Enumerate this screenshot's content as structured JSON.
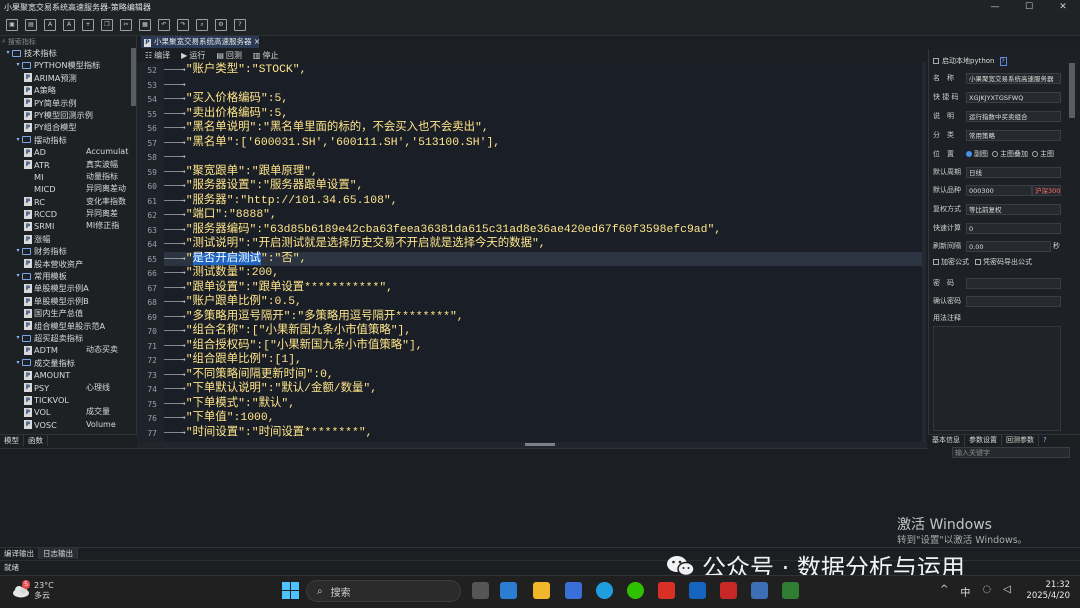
{
  "window": {
    "title": "小果聚宽交易系统高速服务器-策略编辑器",
    "min": "—",
    "max": "☐",
    "close": "✕"
  },
  "left_panel": {
    "search_placeholder": "搜索指标",
    "tree": [
      {
        "indent": 0,
        "type": "folder",
        "label": "技术指标",
        "sub": ""
      },
      {
        "indent": 1,
        "type": "folder",
        "label": "PYTHON模型指标",
        "sub": ""
      },
      {
        "indent": 2,
        "type": "file",
        "label": "ARIMA预测",
        "sub": ""
      },
      {
        "indent": 2,
        "type": "file",
        "label": "A策略",
        "sub": ""
      },
      {
        "indent": 2,
        "type": "file",
        "label": "PY简单示例",
        "sub": ""
      },
      {
        "indent": 2,
        "type": "file",
        "label": "PY模型回测示例",
        "sub": ""
      },
      {
        "indent": 2,
        "type": "file",
        "label": "PY组合模型",
        "sub": ""
      },
      {
        "indent": 1,
        "type": "folder",
        "label": "摆动指标",
        "sub": ""
      },
      {
        "indent": 2,
        "type": "file",
        "label": "AD",
        "sub": "Accumulat"
      },
      {
        "indent": 2,
        "type": "file",
        "label": "ATR",
        "sub": "真实波幅"
      },
      {
        "indent": 2,
        "type": "plain",
        "label": "MI",
        "sub": "动量指标"
      },
      {
        "indent": 2,
        "type": "plain",
        "label": "MICD",
        "sub": "异同离差动"
      },
      {
        "indent": 2,
        "type": "file",
        "label": "RC",
        "sub": "变化率指数"
      },
      {
        "indent": 2,
        "type": "file",
        "label": "RCCD",
        "sub": "异同离差"
      },
      {
        "indent": 2,
        "type": "file",
        "label": "SRMI",
        "sub": "MI修正指"
      },
      {
        "indent": 2,
        "type": "file",
        "label": "涨幅",
        "sub": ""
      },
      {
        "indent": 1,
        "type": "folder",
        "label": "财务指标",
        "sub": ""
      },
      {
        "indent": 2,
        "type": "file",
        "label": "股本营收资产",
        "sub": ""
      },
      {
        "indent": 1,
        "type": "folder",
        "label": "常用模板",
        "sub": ""
      },
      {
        "indent": 2,
        "type": "file",
        "label": "单股模型示例A",
        "sub": ""
      },
      {
        "indent": 2,
        "type": "file",
        "label": "单股模型示例B",
        "sub": ""
      },
      {
        "indent": 2,
        "type": "file",
        "label": "国内生产总值",
        "sub": ""
      },
      {
        "indent": 2,
        "type": "file",
        "label": "组合模型单股示范A",
        "sub": ""
      },
      {
        "indent": 1,
        "type": "folder",
        "label": "超买超卖指标",
        "sub": ""
      },
      {
        "indent": 2,
        "type": "file",
        "label": "ADTM",
        "sub": "动态买卖"
      },
      {
        "indent": 1,
        "type": "folder",
        "label": "成交量指标",
        "sub": ""
      },
      {
        "indent": 2,
        "type": "file",
        "label": "AMOUNT",
        "sub": ""
      },
      {
        "indent": 2,
        "type": "file",
        "label": "PSY",
        "sub": "心理线"
      },
      {
        "indent": 2,
        "type": "file",
        "label": "TICKVOL",
        "sub": ""
      },
      {
        "indent": 2,
        "type": "file",
        "label": "VOL",
        "sub": "成交量"
      },
      {
        "indent": 2,
        "type": "file",
        "label": "VOSC",
        "sub": "Volume"
      }
    ],
    "bottom_tabs": [
      "模型",
      "函数"
    ]
  },
  "editor": {
    "tab_label": "小果聚宽交易系统高速服务器",
    "tab_close": "×",
    "tools": [
      "编译",
      "运行",
      "回测",
      "停止"
    ],
    "lines": [
      {
        "n": "52",
        "text": "\"账户类型\":\"STOCK\","
      },
      {
        "n": "53",
        "text": ""
      },
      {
        "n": "54",
        "text": "\"买入价格编码\":5,"
      },
      {
        "n": "55",
        "text": "\"卖出价格编码\":5,"
      },
      {
        "n": "56",
        "text": "\"黑名单说明\":\"黑名单里面的标的，不会买入也不会卖出\","
      },
      {
        "n": "57",
        "text": "\"黑名单\":['600031.SH','600111.SH','513100.SH'],"
      },
      {
        "n": "58",
        "text": ""
      },
      {
        "n": "59",
        "text": "\"聚宽跟单\":\"跟单原理\","
      },
      {
        "n": "60",
        "text": "\"服务器设置\":\"服务器跟单设置\","
      },
      {
        "n": "61",
        "text": "\"服务器\":\"http://101.34.65.108\","
      },
      {
        "n": "62",
        "text": "\"端口\":\"8888\","
      },
      {
        "n": "63",
        "text": "\"服务器编码\":\"63d85b6189e42cba63feea36381da615c31ad8e36ae420ed67f60f3598efc9ad\","
      },
      {
        "n": "64",
        "text": "\"测试说明\":\"开启测试就是选择历史交易不开启就是选择今天的数据\","
      },
      {
        "n": "65",
        "text": "\"是否开启测试\":\"否\","
      },
      {
        "n": "66",
        "text": "\"测试数量\":200,"
      },
      {
        "n": "67",
        "text": "\"跟单设置\":\"跟单设置***********\","
      },
      {
        "n": "68",
        "text": "\"账户跟单比例\":0.5,"
      },
      {
        "n": "69",
        "text": "\"多策略用逗号隔开\":\"多策略用逗号隔开********\","
      },
      {
        "n": "70",
        "text": "\"组合名称\":[\"小果新国九条小市值策略\"],"
      },
      {
        "n": "71",
        "text": "\"组合授权码\":[\"小果新国九条小市值策略\"],"
      },
      {
        "n": "72",
        "text": "\"组合跟单比例\":[1],"
      },
      {
        "n": "73",
        "text": "\"不同策略间隔更新时间\":0,"
      },
      {
        "n": "74",
        "text": "\"下单默认说明\":\"默认/金额/数量\","
      },
      {
        "n": "75",
        "text": "\"下单模式\":\"默认\","
      },
      {
        "n": "76",
        "text": "\"下单值\":1000,"
      },
      {
        "n": "77",
        "text": "\"时间设置\":\"时间设置********\","
      }
    ],
    "selected_text": "是否开启测试",
    "selected_rest": "\":\"否\","
  },
  "right_panel": {
    "enable_python": "启动本地python",
    "help": "?",
    "name_label": "名　称",
    "name_value": "小果聚宽交易系统高速服务器",
    "code_label": "快 捷 码",
    "code_value": "XGJKJYXTGSFWQ",
    "desc_label": "说　明",
    "desc_value": "运行指数中买卖组合",
    "cat_label": "分　类",
    "cat_value": "常用策略",
    "pos_label": "位　置",
    "pos_options": [
      "副图",
      "主图叠加",
      "主图"
    ],
    "period_label": "默认周期",
    "period_value": "日线",
    "stock_label": "默认品种",
    "stock_value": "000300",
    "stock_badge": "沪深300",
    "rights_label": "复权方式",
    "rights_value": "等比前复权",
    "fast_label": "快速计算",
    "fast_value": "0",
    "refresh_label": "刷新间隔",
    "refresh_value": "0.00",
    "refresh_unit": "秒",
    "encrypt_formula": "加密公式",
    "pwd_export": "凭密码导出公式",
    "pwd_label": "密　码",
    "confirm_label": "确认密码",
    "notes_label": "用法注释",
    "bottom_tabs": [
      "基本信息",
      "参数设置",
      "回测参数"
    ],
    "search_placeholder": "输入关键字"
  },
  "output": {
    "tabs": [
      "编译输出",
      "日志输出"
    ],
    "status": "就绪"
  },
  "watermark": {
    "title": "激活 Windows",
    "subtitle": "转到\"设置\"以激活 Windows。",
    "wechat": "公众号 · 数据分析与运用"
  },
  "taskbar": {
    "temp": "23°C",
    "weather": "多云",
    "badge": "5",
    "search": "搜索",
    "tray_up": "^",
    "ime": "中",
    "time": "21:32",
    "date": "2025/4/20"
  }
}
